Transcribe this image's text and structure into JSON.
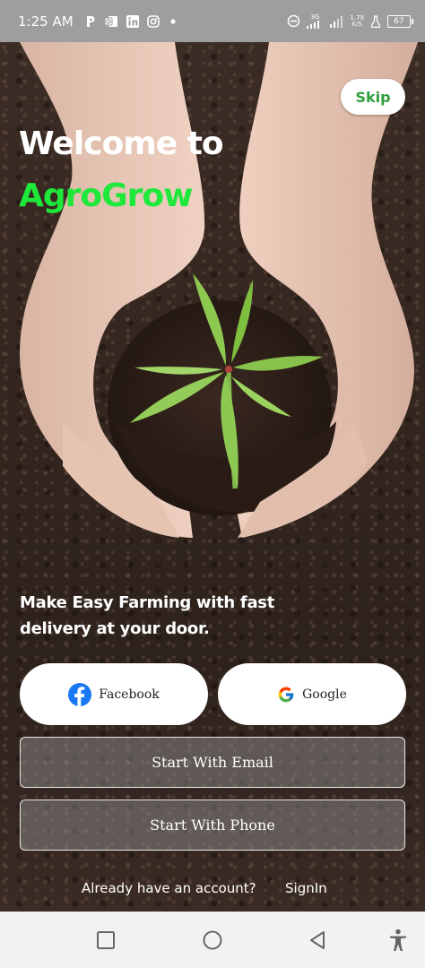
{
  "status_bar": {
    "time": "1:25 AM",
    "left_icons": [
      "p-icon",
      "outlook-icon",
      "linkedin-icon",
      "instagram-icon",
      "dot-icon"
    ],
    "network_type": "3G",
    "speed_value": "1.79",
    "speed_unit": "K/S",
    "battery": "67"
  },
  "skip_label": "Skip",
  "welcome_line": "Welcome to",
  "brand_name": "AgroGrow",
  "tagline": "Make Easy Farming with fast delivery at your door.",
  "buttons": {
    "facebook": "Facebook",
    "google": "Google",
    "email": "Start With Email",
    "phone": "Start With Phone"
  },
  "account": {
    "question": "Already have an account?",
    "signin": "SignIn"
  },
  "colors": {
    "brand_green": "#1ee83a",
    "skip_green": "#2e9e3c",
    "facebook_blue": "#1877f2"
  }
}
